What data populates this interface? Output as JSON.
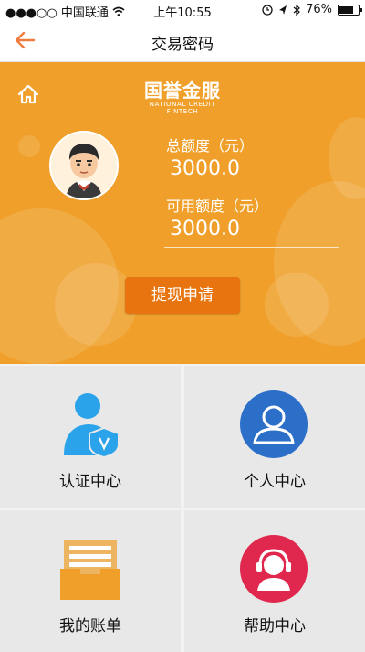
{
  "status_bar": {
    "carrier": "●●●○○ 中国联通",
    "time": "上午10:55",
    "battery_percent": "76%",
    "battery_level": 0.76,
    "icons": [
      "wifi-icon",
      "alarm-icon",
      "location-icon",
      "bluetooth-icon",
      "battery-icon"
    ]
  },
  "header": {
    "title": "交易密码",
    "back_icon": "back-arrow-icon",
    "accent_color": "#f07b3f"
  },
  "hero": {
    "logo_cn": "国誉金服",
    "logo_en": "NATIONAL CREDIT FINTECH",
    "home_icon": "home-icon",
    "total_limit_label": "总额度（元）",
    "total_limit_value": "3000.0",
    "available_limit_label": "可用额度（元）",
    "available_limit_value": "3000.0",
    "withdraw_button": "提现申请",
    "bg_color": "#f0a02a",
    "button_color": "#e8740f"
  },
  "menu": [
    {
      "label": "认证中心",
      "icon": "verified-user-icon"
    },
    {
      "label": "个人中心",
      "icon": "user-profile-icon"
    },
    {
      "label": "我的账单",
      "icon": "bill-icon"
    },
    {
      "label": "帮助中心",
      "icon": "customer-service-icon"
    }
  ]
}
